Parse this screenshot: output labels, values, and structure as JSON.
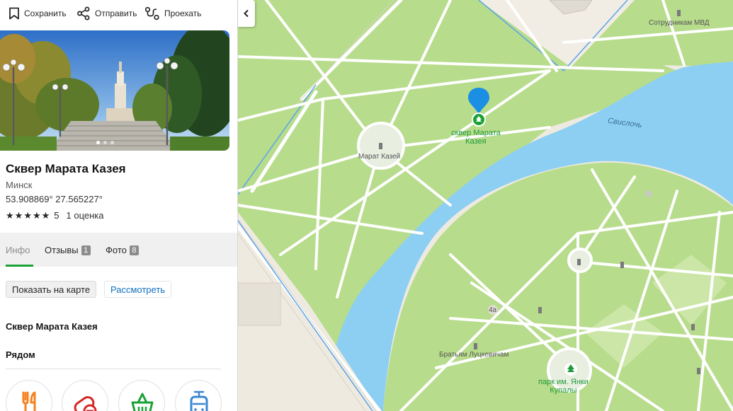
{
  "toolbar": {
    "save_label": "Сохранить",
    "share_label": "Отправить",
    "route_label": "Проехать"
  },
  "place": {
    "title": "Сквер Марата Казея",
    "city": "Минск",
    "coords": "53.908869° 27.565227°",
    "rating": "5",
    "rating_count": "1 оценка",
    "stars": 5
  },
  "photo": {
    "slides": 3,
    "active_slide": 1
  },
  "tabs": [
    {
      "label": "Инфо",
      "count": ""
    },
    {
      "label": "Отзывы",
      "count": "1"
    },
    {
      "label": "Фото",
      "count": "8"
    }
  ],
  "actions": {
    "show_on_map": "Показать на карте",
    "view": "Рассмотреть"
  },
  "sections": {
    "name": "Сквер Марата Казея",
    "nearby": "Рядом"
  },
  "nearby_icons": [
    "food-icon",
    "pharmacy-icon",
    "grocery-icon",
    "transport-icon"
  ],
  "map": {
    "labels": {
      "pin": "сквер Марата\nКазея",
      "monument": "Марат Казей",
      "river": "Свислочь",
      "mvd": "Сотрудникам МВД",
      "brothers": "Братьям Луцкевичам",
      "park": "парк им. Янки\nКупалы",
      "house": "4а"
    }
  },
  "colors": {
    "accent_green": "#1ba136",
    "link_blue": "#0f6fbf",
    "pin_blue": "#1a8fe3",
    "park_green": "#b7dc8c",
    "water": "#8ccff2"
  }
}
